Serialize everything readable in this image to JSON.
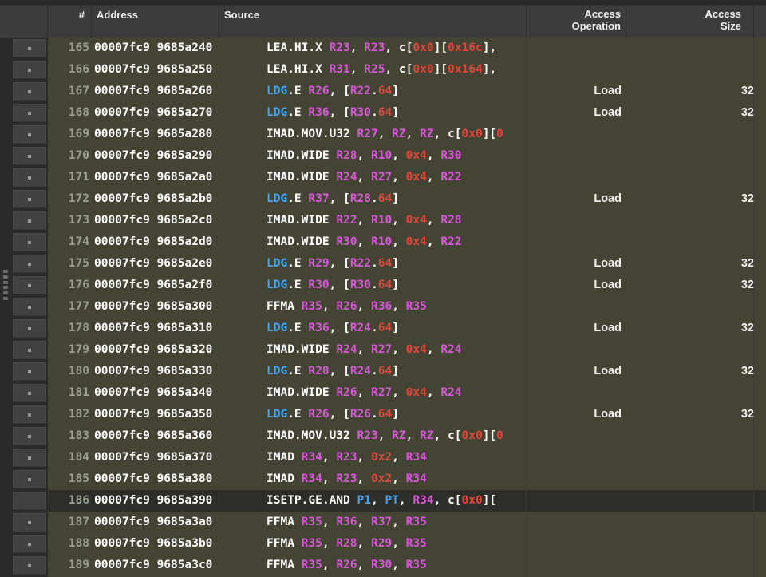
{
  "window": {
    "title": "SASS Disassembly"
  },
  "columns": {
    "gutter": "",
    "number": "#",
    "address": "Address",
    "source": "Source",
    "access_operation": "Access\nOperation",
    "access_size": "Access\nSize",
    "extra": ""
  },
  "colors": {
    "row_background": "#434434",
    "selected_row_background": "#2d2d2a",
    "header_background": "#3c3c3c",
    "gutter_background": "#2b2b2b",
    "opcode": "#ffffff",
    "memory_opcode": "#4aa3e8",
    "register": "#d957d9",
    "predicate": "#4aa3e8",
    "number_literal": "#e0473a",
    "line_number": "#9aa08f",
    "address_text": "#ffffff"
  },
  "rows": [
    {
      "marker": "dot",
      "num": "165",
      "addr": "00007fc9 9685a240",
      "tokens": [
        [
          "op",
          "LEA.HI.X "
        ],
        [
          "reg",
          "R23"
        ],
        [
          "pun",
          ", "
        ],
        [
          "reg",
          "R23"
        ],
        [
          "pun",
          ", c["
        ],
        [
          "num",
          "0x0"
        ],
        [
          "pun",
          "]["
        ],
        [
          "num",
          "0x16c"
        ],
        [
          "pun",
          "],"
        ]
      ],
      "access_operation": "",
      "access_size": "",
      "selected": false
    },
    {
      "marker": "dot",
      "num": "166",
      "addr": "00007fc9 9685a250",
      "tokens": [
        [
          "op",
          "LEA.HI.X "
        ],
        [
          "reg",
          "R31"
        ],
        [
          "pun",
          ", "
        ],
        [
          "reg",
          "R25"
        ],
        [
          "pun",
          ", c["
        ],
        [
          "num",
          "0x0"
        ],
        [
          "pun",
          "]["
        ],
        [
          "num",
          "0x164"
        ],
        [
          "pun",
          "],"
        ]
      ],
      "access_operation": "",
      "access_size": "",
      "selected": false
    },
    {
      "marker": "dot",
      "num": "167",
      "addr": "00007fc9 9685a260",
      "tokens": [
        [
          "mem",
          "LDG"
        ],
        [
          "op",
          ".E "
        ],
        [
          "reg",
          "R26"
        ],
        [
          "pun",
          ", ["
        ],
        [
          "reg",
          "R22"
        ],
        [
          "pun",
          "."
        ],
        [
          "num",
          "64"
        ],
        [
          "pun",
          "]"
        ]
      ],
      "access_operation": "Load",
      "access_size": "32",
      "selected": false
    },
    {
      "marker": "dot",
      "num": "168",
      "addr": "00007fc9 9685a270",
      "tokens": [
        [
          "mem",
          "LDG"
        ],
        [
          "op",
          ".E "
        ],
        [
          "reg",
          "R36"
        ],
        [
          "pun",
          ", ["
        ],
        [
          "reg",
          "R30"
        ],
        [
          "pun",
          "."
        ],
        [
          "num",
          "64"
        ],
        [
          "pun",
          "]"
        ]
      ],
      "access_operation": "Load",
      "access_size": "32",
      "selected": false
    },
    {
      "marker": "dot",
      "num": "169",
      "addr": "00007fc9 9685a280",
      "tokens": [
        [
          "op",
          "IMAD.MOV.U32 "
        ],
        [
          "reg",
          "R27"
        ],
        [
          "pun",
          ", "
        ],
        [
          "reg",
          "RZ"
        ],
        [
          "pun",
          ", "
        ],
        [
          "reg",
          "RZ"
        ],
        [
          "pun",
          ", c["
        ],
        [
          "num",
          "0x0"
        ],
        [
          "pun",
          "]["
        ],
        [
          "num",
          "0"
        ]
      ],
      "access_operation": "",
      "access_size": "",
      "selected": false
    },
    {
      "marker": "dot",
      "num": "170",
      "addr": "00007fc9 9685a290",
      "tokens": [
        [
          "op",
          "IMAD.WIDE "
        ],
        [
          "reg",
          "R28"
        ],
        [
          "pun",
          ", "
        ],
        [
          "reg",
          "R10"
        ],
        [
          "pun",
          ", "
        ],
        [
          "num",
          "0x4"
        ],
        [
          "pun",
          ", "
        ],
        [
          "reg",
          "R30"
        ]
      ],
      "access_operation": "",
      "access_size": "",
      "selected": false
    },
    {
      "marker": "dot",
      "num": "171",
      "addr": "00007fc9 9685a2a0",
      "tokens": [
        [
          "op",
          "IMAD.WIDE "
        ],
        [
          "reg",
          "R24"
        ],
        [
          "pun",
          ", "
        ],
        [
          "reg",
          "R27"
        ],
        [
          "pun",
          ", "
        ],
        [
          "num",
          "0x4"
        ],
        [
          "pun",
          ", "
        ],
        [
          "reg",
          "R22"
        ]
      ],
      "access_operation": "",
      "access_size": "",
      "selected": false
    },
    {
      "marker": "dot",
      "num": "172",
      "addr": "00007fc9 9685a2b0",
      "tokens": [
        [
          "mem",
          "LDG"
        ],
        [
          "op",
          ".E "
        ],
        [
          "reg",
          "R37"
        ],
        [
          "pun",
          ", ["
        ],
        [
          "reg",
          "R28"
        ],
        [
          "pun",
          "."
        ],
        [
          "num",
          "64"
        ],
        [
          "pun",
          "]"
        ]
      ],
      "access_operation": "Load",
      "access_size": "32",
      "selected": false
    },
    {
      "marker": "dot",
      "num": "173",
      "addr": "00007fc9 9685a2c0",
      "tokens": [
        [
          "op",
          "IMAD.WIDE "
        ],
        [
          "reg",
          "R22"
        ],
        [
          "pun",
          ", "
        ],
        [
          "reg",
          "R10"
        ],
        [
          "pun",
          ", "
        ],
        [
          "num",
          "0x4"
        ],
        [
          "pun",
          ", "
        ],
        [
          "reg",
          "R28"
        ]
      ],
      "access_operation": "",
      "access_size": "",
      "selected": false
    },
    {
      "marker": "dot",
      "num": "174",
      "addr": "00007fc9 9685a2d0",
      "tokens": [
        [
          "op",
          "IMAD.WIDE "
        ],
        [
          "reg",
          "R30"
        ],
        [
          "pun",
          ", "
        ],
        [
          "reg",
          "R10"
        ],
        [
          "pun",
          ", "
        ],
        [
          "num",
          "0x4"
        ],
        [
          "pun",
          ", "
        ],
        [
          "reg",
          "R22"
        ]
      ],
      "access_operation": "",
      "access_size": "",
      "selected": false
    },
    {
      "marker": "dot",
      "num": "175",
      "addr": "00007fc9 9685a2e0",
      "tokens": [
        [
          "mem",
          "LDG"
        ],
        [
          "op",
          ".E "
        ],
        [
          "reg",
          "R29"
        ],
        [
          "pun",
          ", ["
        ],
        [
          "reg",
          "R22"
        ],
        [
          "pun",
          "."
        ],
        [
          "num",
          "64"
        ],
        [
          "pun",
          "]"
        ]
      ],
      "access_operation": "Load",
      "access_size": "32",
      "selected": false
    },
    {
      "marker": "dot",
      "num": "176",
      "addr": "00007fc9 9685a2f0",
      "tokens": [
        [
          "mem",
          "LDG"
        ],
        [
          "op",
          ".E "
        ],
        [
          "reg",
          "R30"
        ],
        [
          "pun",
          ", ["
        ],
        [
          "reg",
          "R30"
        ],
        [
          "pun",
          "."
        ],
        [
          "num",
          "64"
        ],
        [
          "pun",
          "]"
        ]
      ],
      "access_operation": "Load",
      "access_size": "32",
      "selected": false
    },
    {
      "marker": "dot",
      "num": "177",
      "addr": "00007fc9 9685a300",
      "tokens": [
        [
          "op",
          "FFMA "
        ],
        [
          "reg",
          "R35"
        ],
        [
          "pun",
          ", "
        ],
        [
          "reg",
          "R26"
        ],
        [
          "pun",
          ", "
        ],
        [
          "reg",
          "R36"
        ],
        [
          "pun",
          ", "
        ],
        [
          "reg",
          "R35"
        ]
      ],
      "access_operation": "",
      "access_size": "",
      "selected": false
    },
    {
      "marker": "dot",
      "num": "178",
      "addr": "00007fc9 9685a310",
      "tokens": [
        [
          "mem",
          "LDG"
        ],
        [
          "op",
          ".E "
        ],
        [
          "reg",
          "R36"
        ],
        [
          "pun",
          ", ["
        ],
        [
          "reg",
          "R24"
        ],
        [
          "pun",
          "."
        ],
        [
          "num",
          "64"
        ],
        [
          "pun",
          "]"
        ]
      ],
      "access_operation": "Load",
      "access_size": "32",
      "selected": false
    },
    {
      "marker": "dot",
      "num": "179",
      "addr": "00007fc9 9685a320",
      "tokens": [
        [
          "op",
          "IMAD.WIDE "
        ],
        [
          "reg",
          "R24"
        ],
        [
          "pun",
          ", "
        ],
        [
          "reg",
          "R27"
        ],
        [
          "pun",
          ", "
        ],
        [
          "num",
          "0x4"
        ],
        [
          "pun",
          ", "
        ],
        [
          "reg",
          "R24"
        ]
      ],
      "access_operation": "",
      "access_size": "",
      "selected": false
    },
    {
      "marker": "dot",
      "num": "180",
      "addr": "00007fc9 9685a330",
      "tokens": [
        [
          "mem",
          "LDG"
        ],
        [
          "op",
          ".E "
        ],
        [
          "reg",
          "R28"
        ],
        [
          "pun",
          ", ["
        ],
        [
          "reg",
          "R24"
        ],
        [
          "pun",
          "."
        ],
        [
          "num",
          "64"
        ],
        [
          "pun",
          "]"
        ]
      ],
      "access_operation": "Load",
      "access_size": "32",
      "selected": false
    },
    {
      "marker": "dot",
      "num": "181",
      "addr": "00007fc9 9685a340",
      "tokens": [
        [
          "op",
          "IMAD.WIDE "
        ],
        [
          "reg",
          "R26"
        ],
        [
          "pun",
          ", "
        ],
        [
          "reg",
          "R27"
        ],
        [
          "pun",
          ", "
        ],
        [
          "num",
          "0x4"
        ],
        [
          "pun",
          ", "
        ],
        [
          "reg",
          "R24"
        ]
      ],
      "access_operation": "",
      "access_size": "",
      "selected": false
    },
    {
      "marker": "dot",
      "num": "182",
      "addr": "00007fc9 9685a350",
      "tokens": [
        [
          "mem",
          "LDG"
        ],
        [
          "op",
          ".E "
        ],
        [
          "reg",
          "R26"
        ],
        [
          "pun",
          ", ["
        ],
        [
          "reg",
          "R26"
        ],
        [
          "pun",
          "."
        ],
        [
          "num",
          "64"
        ],
        [
          "pun",
          "]"
        ]
      ],
      "access_operation": "Load",
      "access_size": "32",
      "selected": false
    },
    {
      "marker": "dot",
      "num": "183",
      "addr": "00007fc9 9685a360",
      "tokens": [
        [
          "op",
          "IMAD.MOV.U32 "
        ],
        [
          "reg",
          "R23"
        ],
        [
          "pun",
          ", "
        ],
        [
          "reg",
          "RZ"
        ],
        [
          "pun",
          ", "
        ],
        [
          "reg",
          "RZ"
        ],
        [
          "pun",
          ", c["
        ],
        [
          "num",
          "0x0"
        ],
        [
          "pun",
          "]["
        ],
        [
          "num",
          "0"
        ]
      ],
      "access_operation": "",
      "access_size": "",
      "selected": false
    },
    {
      "marker": "dot",
      "num": "184",
      "addr": "00007fc9 9685a370",
      "tokens": [
        [
          "op",
          "IMAD "
        ],
        [
          "reg",
          "R34"
        ],
        [
          "pun",
          ", "
        ],
        [
          "reg",
          "R23"
        ],
        [
          "pun",
          ", "
        ],
        [
          "num",
          "0x2"
        ],
        [
          "pun",
          ", "
        ],
        [
          "reg",
          "R34"
        ]
      ],
      "access_operation": "",
      "access_size": "",
      "selected": false
    },
    {
      "marker": "dot",
      "num": "185",
      "addr": "00007fc9 9685a380",
      "tokens": [
        [
          "op",
          "IMAD "
        ],
        [
          "reg",
          "R34"
        ],
        [
          "pun",
          ", "
        ],
        [
          "reg",
          "R23"
        ],
        [
          "pun",
          ", "
        ],
        [
          "num",
          "0x2"
        ],
        [
          "pun",
          ", "
        ],
        [
          "reg",
          "R34"
        ]
      ],
      "access_operation": "",
      "access_size": "",
      "selected": false
    },
    {
      "marker": "none",
      "num": "186",
      "addr": "00007fc9 9685a390",
      "tokens": [
        [
          "op",
          "ISETP.GE.AND "
        ],
        [
          "pred",
          "P1"
        ],
        [
          "pun",
          ", "
        ],
        [
          "pred",
          "PT"
        ],
        [
          "pun",
          ", "
        ],
        [
          "reg",
          "R34"
        ],
        [
          "pun",
          ", c["
        ],
        [
          "num",
          "0x0"
        ],
        [
          "pun",
          "]["
        ]
      ],
      "access_operation": "",
      "access_size": "",
      "selected": true
    },
    {
      "marker": "dot",
      "num": "187",
      "addr": "00007fc9 9685a3a0",
      "tokens": [
        [
          "op",
          "FFMA "
        ],
        [
          "reg",
          "R35"
        ],
        [
          "pun",
          ", "
        ],
        [
          "reg",
          "R36"
        ],
        [
          "pun",
          ", "
        ],
        [
          "reg",
          "R37"
        ],
        [
          "pun",
          ", "
        ],
        [
          "reg",
          "R35"
        ]
      ],
      "access_operation": "",
      "access_size": "",
      "selected": false
    },
    {
      "marker": "dot",
      "num": "188",
      "addr": "00007fc9 9685a3b0",
      "tokens": [
        [
          "op",
          "FFMA "
        ],
        [
          "reg",
          "R35"
        ],
        [
          "pun",
          ", "
        ],
        [
          "reg",
          "R28"
        ],
        [
          "pun",
          ", "
        ],
        [
          "reg",
          "R29"
        ],
        [
          "pun",
          ", "
        ],
        [
          "reg",
          "R35"
        ]
      ],
      "access_operation": "",
      "access_size": "",
      "selected": false
    },
    {
      "marker": "dot",
      "num": "189",
      "addr": "00007fc9 9685a3c0",
      "tokens": [
        [
          "op",
          "FFMA "
        ],
        [
          "reg",
          "R35"
        ],
        [
          "pun",
          ", "
        ],
        [
          "reg",
          "R26"
        ],
        [
          "pun",
          ", "
        ],
        [
          "reg",
          "R30"
        ],
        [
          "pun",
          ", "
        ],
        [
          "reg",
          "R35"
        ]
      ],
      "access_operation": "",
      "access_size": "",
      "selected": false
    }
  ]
}
